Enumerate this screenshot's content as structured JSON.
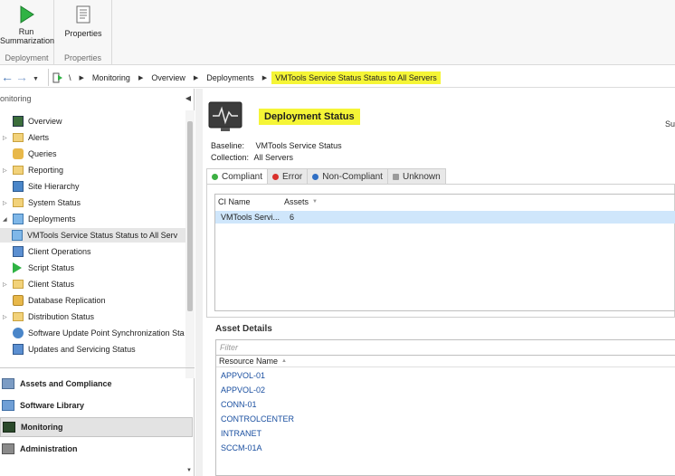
{
  "ribbon": {
    "run_summarization": "Run\nSummarization",
    "run_line1": "Run",
    "run_line2": "Summarization",
    "deployment_group": "Deployment",
    "properties": "Properties",
    "properties_group": "Properties"
  },
  "addressbar": {
    "root": "\\",
    "crumbs": [
      "Monitoring",
      "Overview",
      "Deployments",
      "VMTools Service Status Status to All Servers"
    ]
  },
  "nav": {
    "header": "onitoring",
    "tree": [
      {
        "label": "Overview",
        "icon": "overview-icon"
      },
      {
        "label": "Alerts",
        "icon": "folder-icon"
      },
      {
        "label": "Queries",
        "icon": "queries-icon"
      },
      {
        "label": "Reporting",
        "icon": "folder-icon"
      },
      {
        "label": "Site Hierarchy",
        "icon": "hierarchy-icon"
      },
      {
        "label": "System Status",
        "icon": "folder-icon"
      },
      {
        "label": "Deployments",
        "icon": "deployments-icon"
      },
      {
        "label": "VMTools Service Status Status to All Serv",
        "icon": "deployment-item-icon"
      },
      {
        "label": "Client Operations",
        "icon": "client-ops-icon"
      },
      {
        "label": "Script Status",
        "icon": "play-icon"
      },
      {
        "label": "Client Status",
        "icon": "folder-icon"
      },
      {
        "label": "Database Replication",
        "icon": "database-icon"
      },
      {
        "label": "Distribution Status",
        "icon": "folder-icon"
      },
      {
        "label": "Software Update Point Synchronization Sta",
        "icon": "sync-icon"
      },
      {
        "label": "Updates and Servicing Status",
        "icon": "updates-icon"
      }
    ],
    "workspaces": [
      {
        "label": "Assets and Compliance",
        "icon": "assets-icon"
      },
      {
        "label": "Software Library",
        "icon": "library-icon"
      },
      {
        "label": "Monitoring",
        "icon": "monitoring-icon"
      },
      {
        "label": "Administration",
        "icon": "administration-icon"
      }
    ]
  },
  "content": {
    "title": "Deployment Status",
    "summary_cut": "Su",
    "baseline_label": "Baseline:",
    "baseline_value": "VMTools Service Status",
    "collection_label": "Collection:",
    "collection_value": "All Servers",
    "tabs": [
      {
        "label": "Compliant",
        "color": "#3cb043"
      },
      {
        "label": "Error",
        "color": "#d9302b"
      },
      {
        "label": "Non-Compliant",
        "color": "#2f6fc4"
      },
      {
        "label": "Unknown",
        "color": "#9a9a9a"
      }
    ],
    "grid": {
      "columns": [
        "CI Name",
        "Assets"
      ],
      "rows": [
        {
          "ci_name": "VMTools Servi...",
          "assets": "6"
        }
      ]
    },
    "asset_details": "Asset Details",
    "filter_placeholder": "Filter",
    "resource_column": "Resource Name",
    "resources": [
      "APPVOL-01",
      "APPVOL-02",
      "CONN-01",
      "CONTROLCENTER",
      "INTRANET",
      "SCCM-01A"
    ]
  },
  "colors": {
    "highlight": "#f5f536",
    "selection": "#cfe6fb"
  }
}
